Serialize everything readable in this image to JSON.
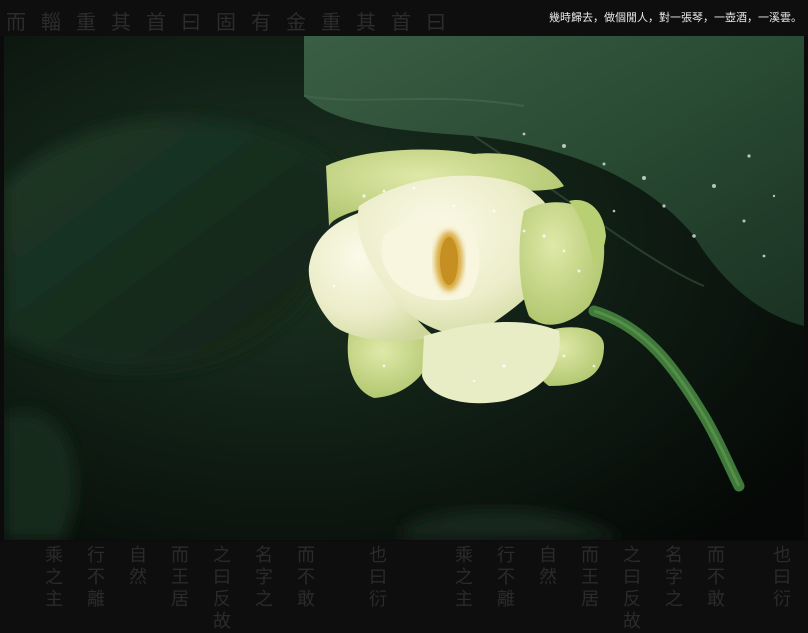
{
  "caption": "幾時歸去，做個閒人，對一張琴，一壺酒，一溪雲。",
  "calligraphy_top": "而輜重其首曰固有金重其首曰",
  "calligraphy_bottom": [
    "乘之主",
    "行不離",
    "自然",
    "而王居",
    "之曰反故",
    "名字之",
    "而不敢",
    "也曰衍",
    "乘之主",
    "行不離",
    "自然",
    "而王居",
    "之曰反故",
    "名字之",
    "而不敢",
    "也曰衍"
  ],
  "colors": {
    "background": "#0b0b0b",
    "leaf_dark": "#14261a",
    "leaf_light": "#2e4e36",
    "petal_cream": "#f3f1d6",
    "petal_green": "#c7d98a",
    "caption_text": "#e8e8e8"
  }
}
